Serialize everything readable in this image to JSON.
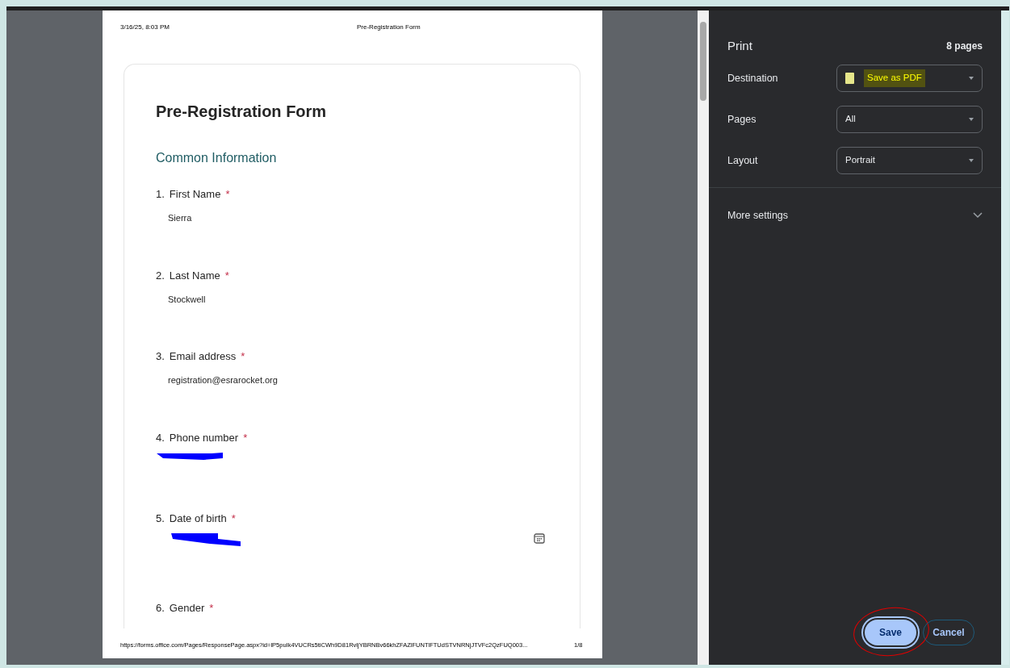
{
  "preview": {
    "header_left": "3/16/25, 8:03 PM",
    "header_center": "Pre-Registration Form",
    "form_title": "Pre-Registration Form",
    "section": "Common Information",
    "questions": [
      {
        "number": "1.",
        "label": "First Name",
        "required_mark": "*",
        "kind": "text",
        "answer": "Sierra"
      },
      {
        "number": "2.",
        "label": "Last Name",
        "required_mark": "*",
        "kind": "text",
        "answer": "Stockwell"
      },
      {
        "number": "3.",
        "label": "Email address",
        "required_mark": "*",
        "kind": "text",
        "answer": "registration@esrarocket.org"
      },
      {
        "number": "4.",
        "label": "Phone number",
        "required_mark": "*",
        "kind": "redacted"
      },
      {
        "number": "5.",
        "label": "Date of birth",
        "required_mark": "*",
        "kind": "redacted",
        "calendar": true
      },
      {
        "number": "6.",
        "label": "Gender",
        "required_mark": "*",
        "kind": "none"
      }
    ],
    "footer_url": "https://forms.office.com/Pages/ResponsePage.aspx?id=lP5puIk4VUCRs5tiCWh9D81RvljYBRNBv66khZFAZlFUNTlFTUdSTVNRNjJTVFc2QzFUQ003...",
    "footer_page": "1/8"
  },
  "panel": {
    "title": "Print",
    "page_count": "8 pages",
    "settings": [
      {
        "label": "Destination",
        "value": "Save as PDF",
        "kind": "destination",
        "highlighted": true
      },
      {
        "label": "Pages",
        "value": "All",
        "kind": "plain",
        "highlighted": false
      },
      {
        "label": "Layout",
        "value": "Portrait",
        "kind": "plain",
        "highlighted": false
      }
    ],
    "more_settings": {
      "label": "More settings",
      "expanded": false
    },
    "buttons": [
      {
        "label": "Save",
        "kind": "primary",
        "circled": true
      },
      {
        "label": "Cancel",
        "kind": "secondary",
        "circled": false
      }
    ]
  }
}
